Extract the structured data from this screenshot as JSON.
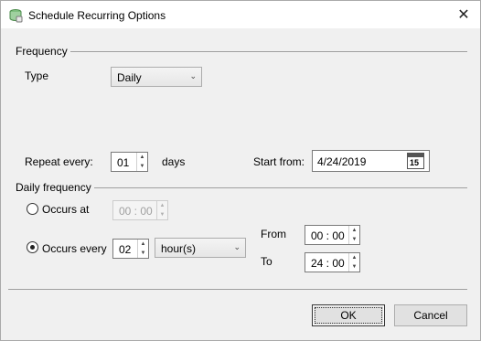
{
  "window": {
    "title": "Schedule Recurring Options",
    "icon": "app-cylinder-icon",
    "close_glyph": "✕"
  },
  "frequency": {
    "group_label": "Frequency",
    "type_label": "Type",
    "type_value": "Daily",
    "repeat_label": "Repeat every:",
    "repeat_value": "01",
    "repeat_unit": "days",
    "start_label": "Start from:",
    "start_value": "4/24/2019",
    "calendar_day": "15"
  },
  "daily": {
    "group_label": "Daily frequency",
    "occurs_at_label": "Occurs at",
    "occurs_at_value": "00 : 00",
    "occurs_every_label": "Occurs every",
    "occurs_every_value": "02",
    "occurs_every_unit": "hour(s)",
    "from_label": "From",
    "from_value": "00 : 00",
    "to_label": "To",
    "to_value": "24 : 00"
  },
  "buttons": {
    "ok": "OK",
    "cancel": "Cancel"
  }
}
